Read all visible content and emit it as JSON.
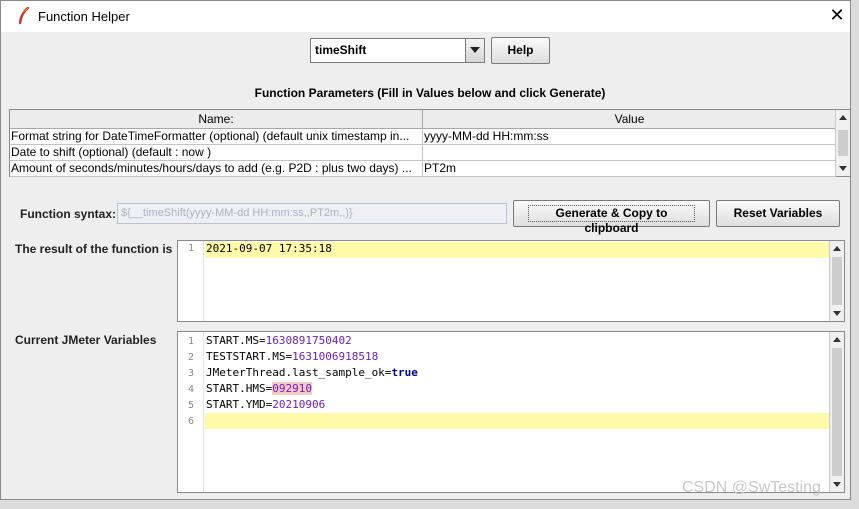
{
  "window": {
    "title": "Function Helper"
  },
  "function_select": {
    "selected": "timeShift"
  },
  "buttons": {
    "help": "Help",
    "generate": "Generate & Copy to clipboard",
    "reset": "Reset Variables"
  },
  "params": {
    "title": "Function Parameters (Fill in Values below and click Generate)",
    "columns": {
      "name": "Name:",
      "value": "Value"
    },
    "rows": [
      {
        "name": "Format string for DateTimeFormatter (optional) (default unix timestamp in...",
        "value": "yyyy-MM-dd HH:mm:ss"
      },
      {
        "name": "Date to shift (optional) (default : now )",
        "value": ""
      },
      {
        "name": "Amount of seconds/minutes/hours/days to add (e.g. P2D : plus two days) ...",
        "value": "PT2m"
      }
    ]
  },
  "syntax": {
    "label": "Function syntax:",
    "value": "${__timeShift(yyyy-MM-dd HH:mm:ss,,PT2m,,)}"
  },
  "result": {
    "label": "The result of the function is",
    "lines": [
      {
        "num": "1",
        "text": "2021-09-07 17:35:18"
      }
    ]
  },
  "variables": {
    "label": "Current JMeter Variables",
    "lines": [
      {
        "num": "1",
        "key": "START.MS=",
        "val": "1630891750402"
      },
      {
        "num": "2",
        "key": "TESTSTART.MS=",
        "val": "1631006918518"
      },
      {
        "num": "3",
        "key": "JMeterThread.last_sample_ok=",
        "val": "true"
      },
      {
        "num": "4",
        "key": "START.HMS=",
        "val": "092910"
      },
      {
        "num": "5",
        "key": "START.YMD=",
        "val": "20210906"
      },
      {
        "num": "6",
        "key": "",
        "val": ""
      }
    ]
  },
  "watermark": "CSDN @SwTesting",
  "colors": {
    "line_highlight": "#fffaa8",
    "number": "#6a1fc4",
    "keyword": "#00008c"
  }
}
